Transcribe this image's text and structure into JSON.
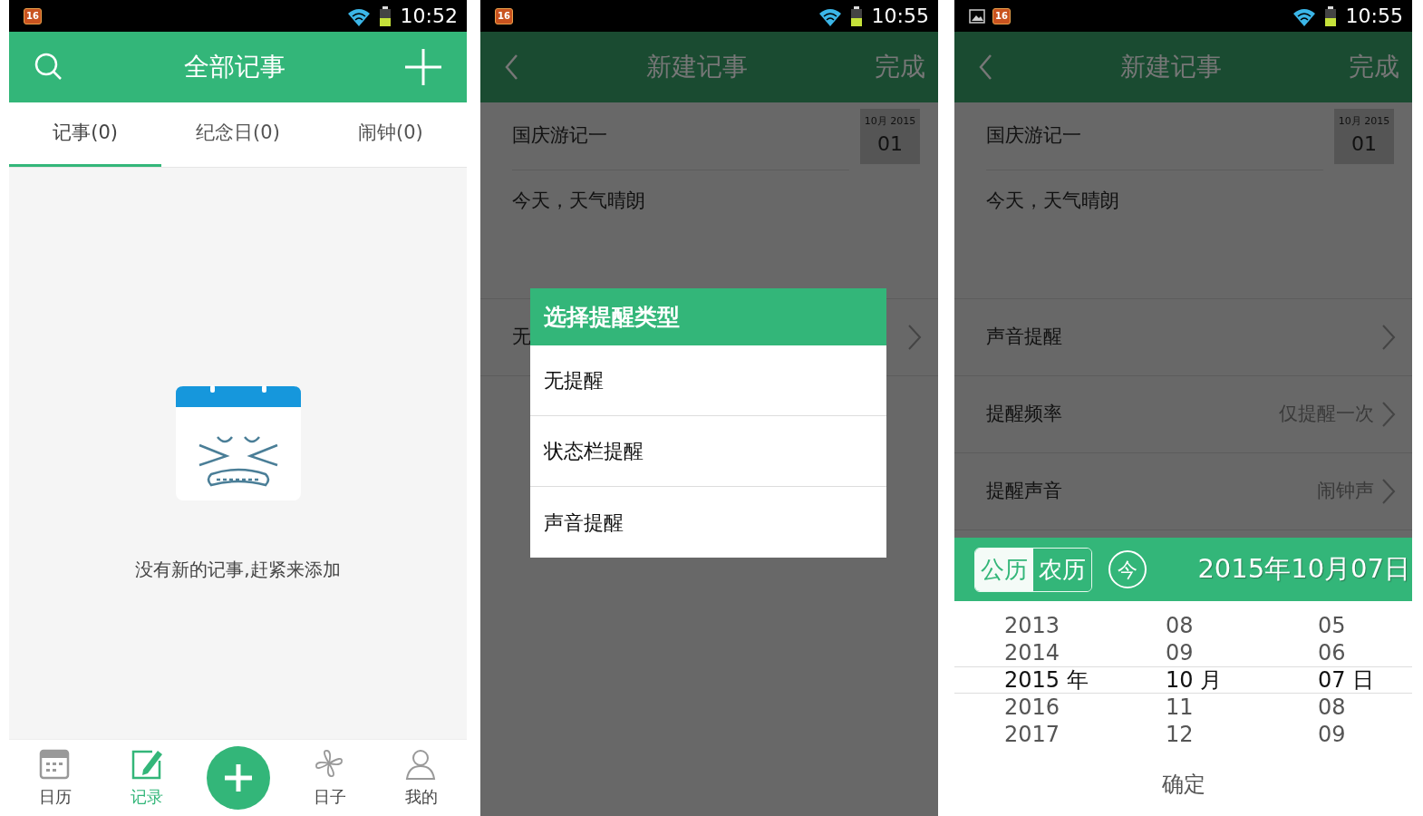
{
  "screens": [
    {
      "kind": "notes_list",
      "dimmed": false,
      "status_bar": {
        "badge": "16",
        "time": "10:52"
      },
      "header": {
        "title": "全部记事"
      },
      "tabs": [
        {
          "label": "记事(0)",
          "selected": true
        },
        {
          "label": "纪念日(0)",
          "selected": false
        },
        {
          "label": "闹钟(0)",
          "selected": false
        }
      ],
      "empty_message": "没有新的记事,赶紧来添加",
      "bottom_nav": [
        {
          "kind": "tab",
          "label": "日历",
          "selected": false
        },
        {
          "kind": "tab",
          "label": "记录",
          "selected": true
        },
        {
          "kind": "add"
        },
        {
          "kind": "tab",
          "label": "日子",
          "selected": false
        },
        {
          "kind": "tab",
          "label": "我的",
          "selected": false
        }
      ]
    },
    {
      "kind": "reminder_dialog",
      "dimmed": true,
      "status_bar": {
        "badge": "16",
        "time": "10:55"
      },
      "header": {
        "title": "新建记事",
        "action": "完成"
      },
      "note": {
        "title": "国庆游记一",
        "date_label": "10月 2015",
        "day": "01",
        "body": "今天，天气晴朗"
      },
      "reminder_rows": [
        {
          "label": "无"
        }
      ],
      "dialog": {
        "title": "选择提醒类型",
        "options": [
          "无提醒",
          "状态栏提醒",
          "声音提醒"
        ]
      }
    },
    {
      "kind": "date_picker",
      "dimmed": true,
      "status_bar": {
        "badge": "16",
        "time": "10:55"
      },
      "header": {
        "title": "新建记事",
        "action": "完成"
      },
      "note": {
        "title": "国庆游记一",
        "date_label": "10月 2015",
        "day": "01",
        "body": "今天，天气晴朗"
      },
      "reminder_rows": [
        {
          "label": "声音提醒"
        },
        {
          "label": "提醒频率",
          "value": "仅提醒一次"
        },
        {
          "label": "提醒声音",
          "value": "闹钟声"
        }
      ],
      "picker": {
        "calendars": [
          {
            "label": "公历",
            "selected": true
          },
          {
            "label": "农历",
            "selected": false
          }
        ],
        "today": "今",
        "date": "2015年10月07日",
        "wheels": [
          [
            {
              "text": "2013",
              "selected": false
            },
            {
              "text": "2014",
              "selected": false
            },
            {
              "text": "2015 年",
              "selected": true
            },
            {
              "text": "2016",
              "selected": false
            },
            {
              "text": "2017",
              "selected": false
            }
          ],
          [
            {
              "text": "08",
              "selected": false
            },
            {
              "text": "09",
              "selected": false
            },
            {
              "text": "10 月",
              "selected": true
            },
            {
              "text": "11",
              "selected": false
            },
            {
              "text": "12",
              "selected": false
            }
          ],
          [
            {
              "text": "05",
              "selected": false
            },
            {
              "text": "06",
              "selected": false
            },
            {
              "text": "07 日",
              "selected": true
            },
            {
              "text": "08",
              "selected": false
            },
            {
              "text": "09",
              "selected": false
            }
          ]
        ],
        "confirm": "确定"
      }
    }
  ]
}
